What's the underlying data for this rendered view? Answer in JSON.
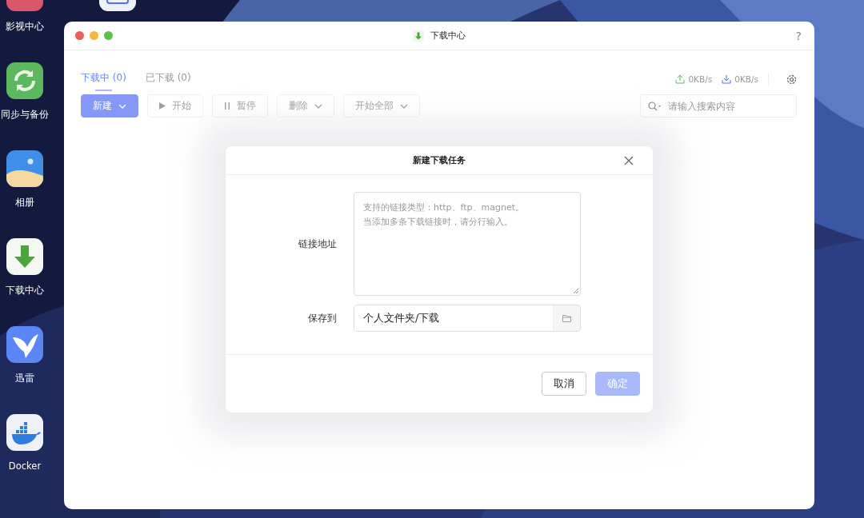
{
  "desktop_apps": [
    {
      "label": "影视中心"
    },
    {
      "label": "同步与备份"
    },
    {
      "label": "相册"
    },
    {
      "label": "下载中心"
    },
    {
      "label": "迅雷"
    },
    {
      "label": "Docker"
    }
  ],
  "window": {
    "title": "下载中心",
    "help": "?"
  },
  "tabs": [
    {
      "label": "下载中 (0)",
      "selected": true
    },
    {
      "label": "已下载 (0)",
      "selected": false
    }
  ],
  "speeds": [
    {
      "kind": "upload",
      "value": "0KB/s"
    },
    {
      "kind": "download",
      "value": "0KB/s"
    }
  ],
  "toolbar": [
    {
      "label": "新建",
      "kind": "primary",
      "dropdown": true,
      "disabled": false
    },
    {
      "label": "开始",
      "kind": "default",
      "dropdown": false,
      "disabled": true
    },
    {
      "label": "暂停",
      "kind": "default",
      "dropdown": false,
      "disabled": true
    },
    {
      "label": "删除",
      "kind": "default",
      "dropdown": true,
      "disabled": true
    },
    {
      "label": "开始全部",
      "kind": "default",
      "dropdown": true,
      "disabled": true
    }
  ],
  "search": {
    "placeholder": "请输入搜索内容"
  },
  "dialog": {
    "title": "新建下载任务",
    "link_field": {
      "label": "链接地址",
      "placeholder_lines": [
        "支持的链接类型：http、ftp、magnet。",
        "当添加多条下载链接时，请分行输入。"
      ]
    },
    "save_field": {
      "label": "保存到",
      "value": "个人文件夹/下载"
    },
    "buttons": [
      {
        "label": "取消",
        "kind": "default",
        "disabled": false
      },
      {
        "label": "确定",
        "kind": "primary",
        "disabled": true
      }
    ]
  }
}
